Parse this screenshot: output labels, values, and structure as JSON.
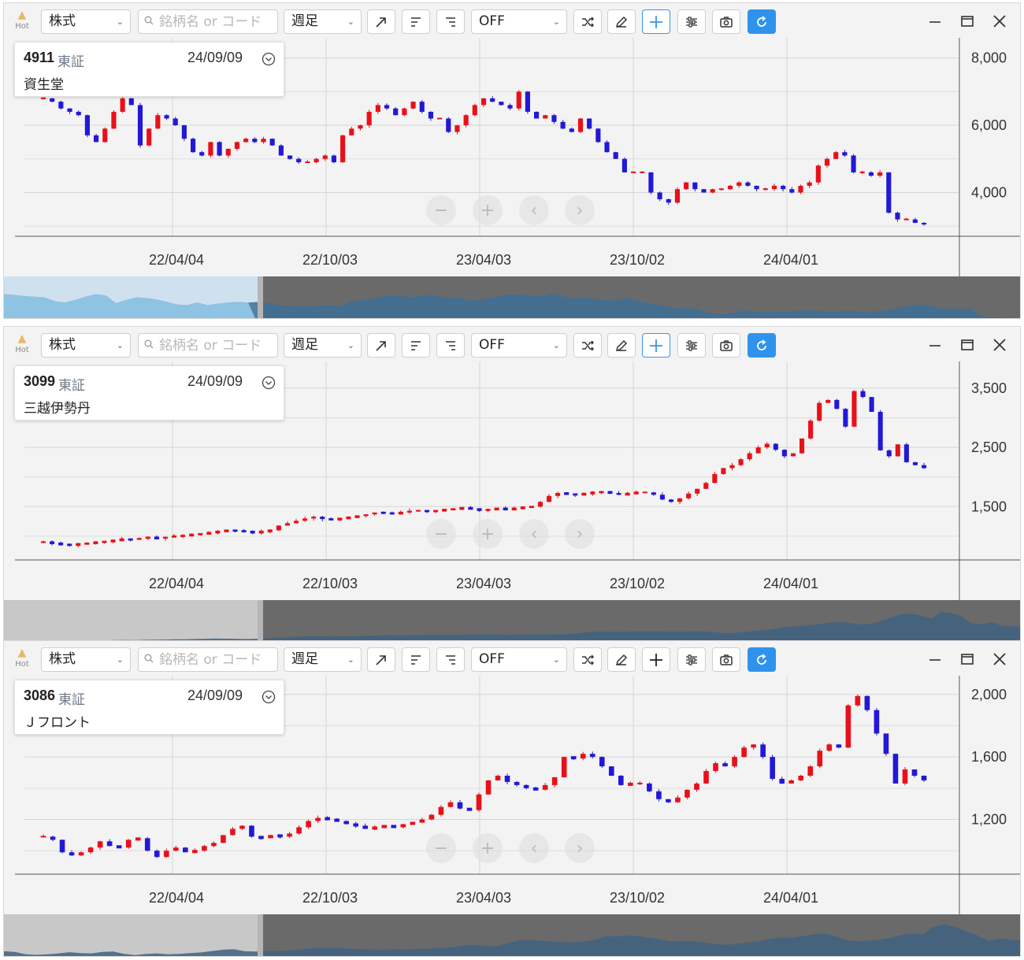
{
  "toolbar": {
    "hot_label": "Hot",
    "category": "株式",
    "search_placeholder": "銘柄名 or コード",
    "period": "週足",
    "indicator": "OFF"
  },
  "colors": {
    "up": "#e8101a",
    "down": "#2218d6",
    "accent": "#2f93ee",
    "navigator": "#6a6a6a"
  },
  "icons": [
    "fire-icon",
    "search-icon",
    "trend-line-icon",
    "align-left-icon",
    "align-right-icon",
    "shuffle-icon",
    "pencil-icon",
    "crosshair-icon",
    "settings-sliders-icon",
    "camera-icon",
    "refresh-icon",
    "minimize-icon",
    "maximize-icon",
    "close-icon",
    "expand-circle-icon"
  ],
  "charts": [
    {
      "code": "4911",
      "market": "東証",
      "date": "24/09/09",
      "name": "資生堂",
      "crosshair_active": true
    },
    {
      "code": "3099",
      "market": "東証",
      "date": "24/09/09",
      "name": "三越伊勢丹",
      "crosshair_active": true
    },
    {
      "code": "3086",
      "market": "東証",
      "date": "24/09/09",
      "name": "Ｊフロント",
      "crosshair_active": false
    }
  ],
  "chart_data": [
    {
      "type": "candlestick",
      "x_labels": [
        "22/04/04",
        "22/10/03",
        "23/04/03",
        "23/10/02",
        "24/04/01"
      ],
      "y_ticks": [
        4000,
        6000,
        8000
      ],
      "ylim": [
        2700,
        8600
      ],
      "series": [
        6800,
        6700,
        6500,
        6400,
        6300,
        5700,
        5500,
        5900,
        6400,
        6800,
        6600,
        5400,
        5900,
        6300,
        6200,
        6000,
        5600,
        5200,
        5100,
        5500,
        5100,
        5300,
        5500,
        5600,
        5500,
        5600,
        5400,
        5100,
        5000,
        4900,
        4900,
        5000,
        5100,
        4900,
        5700,
        5900,
        6000,
        6400,
        6600,
        6500,
        6300,
        6500,
        6700,
        6400,
        6200,
        6200,
        5800,
        6000,
        6300,
        6600,
        6800,
        6700,
        6600,
        6500,
        7000,
        6400,
        6200,
        6300,
        6100,
        5900,
        5800,
        6200,
        5900,
        5500,
        5200,
        5000,
        4600,
        4600,
        4600,
        4000,
        3800,
        3700,
        4100,
        4300,
        4100,
        4000,
        4100,
        4100,
        4200,
        4300,
        4200,
        4100,
        4100,
        4200,
        4100,
        4000,
        4200,
        4300,
        4800,
        5000,
        5200,
        5100,
        4600,
        4600,
        4500,
        4600,
        3400,
        3200,
        3200,
        3100,
        3050
      ],
      "grid": true
    },
    {
      "type": "candlestick",
      "x_labels": [
        "22/04/04",
        "22/10/03",
        "23/04/03",
        "23/10/02",
        "24/04/01"
      ],
      "y_ticks": [
        1500,
        2500,
        3500
      ],
      "ylim": [
        600,
        3950
      ],
      "series": [
        900,
        880,
        860,
        850,
        870,
        880,
        900,
        910,
        930,
        950,
        940,
        970,
        980,
        960,
        990,
        1000,
        1010,
        1030,
        1040,
        1060,
        1080,
        1100,
        1090,
        1080,
        1060,
        1080,
        1100,
        1180,
        1220,
        1260,
        1300,
        1330,
        1290,
        1280,
        1300,
        1320,
        1340,
        1370,
        1400,
        1390,
        1380,
        1400,
        1430,
        1430,
        1420,
        1430,
        1450,
        1460,
        1480,
        1460,
        1440,
        1450,
        1470,
        1450,
        1470,
        1490,
        1500,
        1580,
        1680,
        1730,
        1710,
        1700,
        1720,
        1740,
        1750,
        1730,
        1700,
        1720,
        1740,
        1740,
        1700,
        1620,
        1580,
        1640,
        1720,
        1800,
        1900,
        2050,
        2150,
        2200,
        2300,
        2400,
        2500,
        2560,
        2460,
        2350,
        2400,
        2650,
        2950,
        3250,
        3300,
        3150,
        2850,
        3450,
        3350,
        3100,
        2450,
        2350,
        2550,
        2250,
        2200,
        2150
      ],
      "grid": true
    },
    {
      "type": "candlestick",
      "x_labels": [
        "22/04/04",
        "22/10/03",
        "23/04/03",
        "23/10/02",
        "24/04/01"
      ],
      "y_ticks": [
        1200,
        1600,
        2000
      ],
      "ylim": [
        850,
        2120
      ],
      "series": [
        1090,
        1070,
        990,
        970,
        990,
        1020,
        1060,
        1030,
        1020,
        1070,
        1080,
        1000,
        960,
        1000,
        1020,
        990,
        1000,
        1030,
        1050,
        1100,
        1140,
        1160,
        1090,
        1080,
        1100,
        1090,
        1110,
        1150,
        1190,
        1210,
        1200,
        1190,
        1170,
        1160,
        1140,
        1150,
        1160,
        1150,
        1170,
        1180,
        1200,
        1230,
        1280,
        1310,
        1270,
        1260,
        1360,
        1450,
        1480,
        1440,
        1420,
        1400,
        1390,
        1420,
        1470,
        1600,
        1590,
        1620,
        1600,
        1540,
        1480,
        1420,
        1430,
        1430,
        1380,
        1330,
        1310,
        1340,
        1390,
        1430,
        1510,
        1560,
        1540,
        1600,
        1660,
        1680,
        1600,
        1460,
        1430,
        1450,
        1480,
        1540,
        1640,
        1680,
        1660,
        1930,
        1990,
        1900,
        1750,
        1620,
        1430,
        1520,
        1480,
        1450
      ]
    }
  ]
}
